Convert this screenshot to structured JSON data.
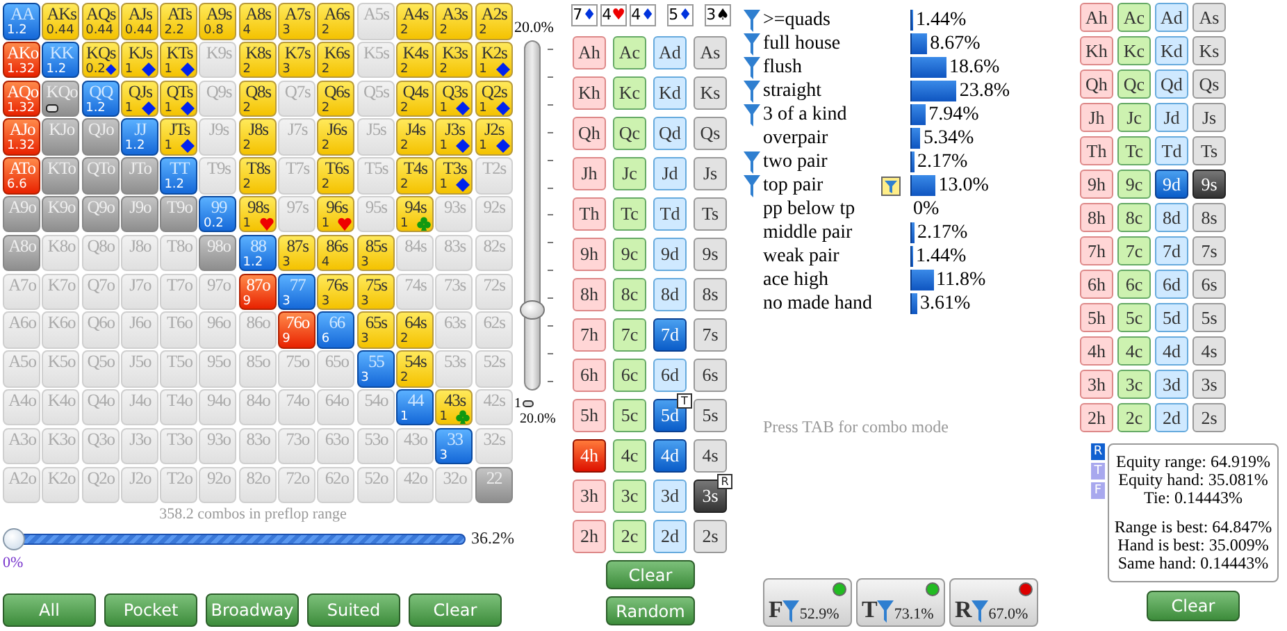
{
  "hand_grid": {
    "rows": [
      [
        {
          "label": "AA",
          "kind": "pair",
          "count": "1.2"
        },
        {
          "label": "AKs",
          "kind": "suited",
          "count": "0.44"
        },
        {
          "label": "AQs",
          "kind": "suited",
          "count": "0.44"
        },
        {
          "label": "AJs",
          "kind": "suited",
          "count": "0.44"
        },
        {
          "label": "ATs",
          "kind": "suited",
          "count": "2.2"
        },
        {
          "label": "A9s",
          "kind": "suited",
          "count": "0.8"
        },
        {
          "label": "A8s",
          "kind": "suited",
          "count": "4"
        },
        {
          "label": "A7s",
          "kind": "suited",
          "count": "3"
        },
        {
          "label": "A6s",
          "kind": "suited",
          "count": "2"
        },
        {
          "label": "A5s",
          "kind": "empty"
        },
        {
          "label": "A4s",
          "kind": "suited",
          "count": "2"
        },
        {
          "label": "A3s",
          "kind": "suited",
          "count": "2"
        },
        {
          "label": "A2s",
          "kind": "suited",
          "count": "2"
        }
      ],
      [
        {
          "label": "AKo",
          "kind": "offsuit",
          "count": "1.32"
        },
        {
          "label": "KK",
          "kind": "pair",
          "count": "1.2"
        },
        {
          "label": "KQs",
          "kind": "suited",
          "count": "0.2",
          "marker": {
            "kind": "diamond"
          }
        },
        {
          "label": "KJs",
          "kind": "suited",
          "count": "1",
          "marker": {
            "kind": "diamond"
          }
        },
        {
          "label": "KTs",
          "kind": "suited",
          "count": "1",
          "marker": {
            "kind": "diamond"
          }
        },
        {
          "label": "K9s",
          "kind": "empty"
        },
        {
          "label": "K8s",
          "kind": "suited",
          "count": "2"
        },
        {
          "label": "K7s",
          "kind": "suited",
          "count": "3"
        },
        {
          "label": "K6s",
          "kind": "suited",
          "count": "2"
        },
        {
          "label": "K5s",
          "kind": "empty"
        },
        {
          "label": "K4s",
          "kind": "suited",
          "count": "2"
        },
        {
          "label": "K3s",
          "kind": "suited",
          "count": "2"
        },
        {
          "label": "K2s",
          "kind": "suited",
          "count": "1",
          "marker": {
            "kind": "diamond"
          }
        }
      ],
      [
        {
          "label": "AQo",
          "kind": "offsuit",
          "count": "1.32"
        },
        {
          "label": "KQo",
          "kind": "dim",
          "marker": {
            "kind": "note"
          }
        },
        {
          "label": "QQ",
          "kind": "pair",
          "count": "1.2"
        },
        {
          "label": "QJs",
          "kind": "suited",
          "count": "1",
          "marker": {
            "kind": "diamond"
          }
        },
        {
          "label": "QTs",
          "kind": "suited",
          "count": "1",
          "marker": {
            "kind": "diamond"
          }
        },
        {
          "label": "Q9s",
          "kind": "empty"
        },
        {
          "label": "Q8s",
          "kind": "suited",
          "count": "2"
        },
        {
          "label": "Q7s",
          "kind": "empty"
        },
        {
          "label": "Q6s",
          "kind": "suited",
          "count": "2"
        },
        {
          "label": "Q5s",
          "kind": "empty"
        },
        {
          "label": "Q4s",
          "kind": "suited",
          "count": "2"
        },
        {
          "label": "Q3s",
          "kind": "suited",
          "count": "1",
          "marker": {
            "kind": "diamond"
          }
        },
        {
          "label": "Q2s",
          "kind": "suited",
          "count": "1",
          "marker": {
            "kind": "diamond"
          }
        }
      ],
      [
        {
          "label": "AJo",
          "kind": "offsuit",
          "count": "1.32"
        },
        {
          "label": "KJo",
          "kind": "dim"
        },
        {
          "label": "QJo",
          "kind": "dim"
        },
        {
          "label": "JJ",
          "kind": "pair",
          "count": "1.2"
        },
        {
          "label": "JTs",
          "kind": "suited",
          "count": "1",
          "marker": {
            "kind": "diamond"
          }
        },
        {
          "label": "J9s",
          "kind": "empty"
        },
        {
          "label": "J8s",
          "kind": "suited",
          "count": "2"
        },
        {
          "label": "J7s",
          "kind": "empty"
        },
        {
          "label": "J6s",
          "kind": "suited",
          "count": "2"
        },
        {
          "label": "J5s",
          "kind": "empty"
        },
        {
          "label": "J4s",
          "kind": "suited",
          "count": "2"
        },
        {
          "label": "J3s",
          "kind": "suited",
          "count": "1",
          "marker": {
            "kind": "diamond"
          }
        },
        {
          "label": "J2s",
          "kind": "suited",
          "count": "1",
          "marker": {
            "kind": "diamond"
          }
        }
      ],
      [
        {
          "label": "ATo",
          "kind": "offsuit",
          "count": "6.6"
        },
        {
          "label": "KTo",
          "kind": "dim"
        },
        {
          "label": "QTo",
          "kind": "dim"
        },
        {
          "label": "JTo",
          "kind": "dim"
        },
        {
          "label": "TT",
          "kind": "pair",
          "count": "1.2"
        },
        {
          "label": "T9s",
          "kind": "empty"
        },
        {
          "label": "T8s",
          "kind": "suited",
          "count": "2"
        },
        {
          "label": "T7s",
          "kind": "empty"
        },
        {
          "label": "T6s",
          "kind": "suited",
          "count": "2"
        },
        {
          "label": "T5s",
          "kind": "empty"
        },
        {
          "label": "T4s",
          "kind": "suited",
          "count": "2"
        },
        {
          "label": "T3s",
          "kind": "suited",
          "count": "1",
          "marker": {
            "kind": "diamond"
          }
        },
        {
          "label": "T2s",
          "kind": "empty"
        }
      ],
      [
        {
          "label": "A9o",
          "kind": "dim"
        },
        {
          "label": "K9o",
          "kind": "dim"
        },
        {
          "label": "Q9o",
          "kind": "dim"
        },
        {
          "label": "J9o",
          "kind": "dim"
        },
        {
          "label": "T9o",
          "kind": "dim"
        },
        {
          "label": "99",
          "kind": "pair",
          "count": "0.2"
        },
        {
          "label": "98s",
          "kind": "suited",
          "count": "1",
          "marker": {
            "kind": "heart"
          }
        },
        {
          "label": "97s",
          "kind": "empty"
        },
        {
          "label": "96s",
          "kind": "suited",
          "count": "1",
          "marker": {
            "kind": "heart"
          }
        },
        {
          "label": "95s",
          "kind": "empty"
        },
        {
          "label": "94s",
          "kind": "suited",
          "count": "1",
          "marker": {
            "kind": "club"
          }
        },
        {
          "label": "93s",
          "kind": "empty"
        },
        {
          "label": "92s",
          "kind": "empty"
        }
      ],
      [
        {
          "label": "A8o",
          "kind": "dim"
        },
        {
          "label": "K8o",
          "kind": "empty"
        },
        {
          "label": "Q8o",
          "kind": "empty"
        },
        {
          "label": "J8o",
          "kind": "empty"
        },
        {
          "label": "T8o",
          "kind": "empty"
        },
        {
          "label": "98o",
          "kind": "dim"
        },
        {
          "label": "88",
          "kind": "pair",
          "count": "1.2"
        },
        {
          "label": "87s",
          "kind": "suited",
          "count": "3"
        },
        {
          "label": "86s",
          "kind": "suited",
          "count": "4"
        },
        {
          "label": "85s",
          "kind": "suited",
          "count": "3"
        },
        {
          "label": "84s",
          "kind": "empty"
        },
        {
          "label": "83s",
          "kind": "empty"
        },
        {
          "label": "82s",
          "kind": "empty"
        }
      ],
      [
        {
          "label": "A7o",
          "kind": "empty"
        },
        {
          "label": "K7o",
          "kind": "empty"
        },
        {
          "label": "Q7o",
          "kind": "empty"
        },
        {
          "label": "J7o",
          "kind": "empty"
        },
        {
          "label": "T7o",
          "kind": "empty"
        },
        {
          "label": "97o",
          "kind": "empty"
        },
        {
          "label": "87o",
          "kind": "offsuit",
          "count": "9"
        },
        {
          "label": "77",
          "kind": "pair",
          "count": "3"
        },
        {
          "label": "76s",
          "kind": "suited",
          "count": "3"
        },
        {
          "label": "75s",
          "kind": "suited",
          "count": "3"
        },
        {
          "label": "74s",
          "kind": "empty"
        },
        {
          "label": "73s",
          "kind": "empty"
        },
        {
          "label": "72s",
          "kind": "empty"
        }
      ],
      [
        {
          "label": "A6o",
          "kind": "empty"
        },
        {
          "label": "K6o",
          "kind": "empty"
        },
        {
          "label": "Q6o",
          "kind": "empty"
        },
        {
          "label": "J6o",
          "kind": "empty"
        },
        {
          "label": "T6o",
          "kind": "empty"
        },
        {
          "label": "96o",
          "kind": "empty"
        },
        {
          "label": "86o",
          "kind": "empty"
        },
        {
          "label": "76o",
          "kind": "offsuit",
          "count": "9"
        },
        {
          "label": "66",
          "kind": "pair",
          "count": "6"
        },
        {
          "label": "65s",
          "kind": "suited",
          "count": "3"
        },
        {
          "label": "64s",
          "kind": "suited",
          "count": "2"
        },
        {
          "label": "63s",
          "kind": "empty"
        },
        {
          "label": "62s",
          "kind": "empty"
        }
      ],
      [
        {
          "label": "A5o",
          "kind": "empty"
        },
        {
          "label": "K5o",
          "kind": "empty"
        },
        {
          "label": "Q5o",
          "kind": "empty"
        },
        {
          "label": "J5o",
          "kind": "empty"
        },
        {
          "label": "T5o",
          "kind": "empty"
        },
        {
          "label": "95o",
          "kind": "empty"
        },
        {
          "label": "85o",
          "kind": "empty"
        },
        {
          "label": "75o",
          "kind": "empty"
        },
        {
          "label": "65o",
          "kind": "empty"
        },
        {
          "label": "55",
          "kind": "pair",
          "count": "3"
        },
        {
          "label": "54s",
          "kind": "suited",
          "count": "2"
        },
        {
          "label": "53s",
          "kind": "empty"
        },
        {
          "label": "52s",
          "kind": "empty"
        }
      ],
      [
        {
          "label": "A4o",
          "kind": "empty"
        },
        {
          "label": "K4o",
          "kind": "empty"
        },
        {
          "label": "Q4o",
          "kind": "empty"
        },
        {
          "label": "J4o",
          "kind": "empty"
        },
        {
          "label": "T4o",
          "kind": "empty"
        },
        {
          "label": "94o",
          "kind": "empty"
        },
        {
          "label": "84o",
          "kind": "empty"
        },
        {
          "label": "74o",
          "kind": "empty"
        },
        {
          "label": "64o",
          "kind": "empty"
        },
        {
          "label": "54o",
          "kind": "empty"
        },
        {
          "label": "44",
          "kind": "pair",
          "count": "1"
        },
        {
          "label": "43s",
          "kind": "suited",
          "count": "1",
          "marker": {
            "kind": "club"
          }
        },
        {
          "label": "42s",
          "kind": "empty"
        }
      ],
      [
        {
          "label": "A3o",
          "kind": "empty"
        },
        {
          "label": "K3o",
          "kind": "empty"
        },
        {
          "label": "Q3o",
          "kind": "empty"
        },
        {
          "label": "J3o",
          "kind": "empty"
        },
        {
          "label": "T3o",
          "kind": "empty"
        },
        {
          "label": "93o",
          "kind": "empty"
        },
        {
          "label": "83o",
          "kind": "empty"
        },
        {
          "label": "73o",
          "kind": "empty"
        },
        {
          "label": "63o",
          "kind": "empty"
        },
        {
          "label": "53o",
          "kind": "empty"
        },
        {
          "label": "43o",
          "kind": "empty"
        },
        {
          "label": "33",
          "kind": "pair",
          "count": "3"
        },
        {
          "label": "32s",
          "kind": "empty"
        }
      ],
      [
        {
          "label": "A2o",
          "kind": "empty"
        },
        {
          "label": "K2o",
          "kind": "empty"
        },
        {
          "label": "Q2o",
          "kind": "empty"
        },
        {
          "label": "J2o",
          "kind": "empty"
        },
        {
          "label": "T2o",
          "kind": "empty"
        },
        {
          "label": "92o",
          "kind": "empty"
        },
        {
          "label": "82o",
          "kind": "empty"
        },
        {
          "label": "72o",
          "kind": "empty"
        },
        {
          "label": "62o",
          "kind": "empty"
        },
        {
          "label": "52o",
          "kind": "empty"
        },
        {
          "label": "42o",
          "kind": "empty"
        },
        {
          "label": "32o",
          "kind": "empty"
        },
        {
          "label": "22",
          "kind": "dim"
        }
      ]
    ]
  },
  "preflop": {
    "combos_text": "358.2 combos in preflop range",
    "min_label": "0%",
    "max_label": "36.2%"
  },
  "range_buttons": [
    "All",
    "Pocket",
    "Broadway",
    "Suited",
    "Clear"
  ],
  "vertical_slider": {
    "top_label": "20.0%",
    "level": 0.23,
    "bottom_value": "1",
    "bottom_label": "20.0%"
  },
  "board": [
    {
      "rank": "7",
      "suit": "♦",
      "color": "#0033dd"
    },
    {
      "rank": "4",
      "suit": "♥",
      "color": "#ee0000"
    },
    {
      "rank": "4",
      "suit": "♦",
      "color": "#0033dd"
    },
    {
      "rank": "5",
      "suit": "♦",
      "color": "#0033dd"
    },
    {
      "rank": "3",
      "suit": "♠",
      "color": "#000000"
    }
  ],
  "board_cards": [
    [
      {
        "label": "Ah",
        "kind": "normal"
      },
      {
        "label": "Ac",
        "kind": "normal"
      },
      {
        "label": "Ad",
        "kind": "normal"
      },
      {
        "label": "As",
        "kind": "normal"
      }
    ],
    [
      {
        "label": "Kh",
        "kind": "normal"
      },
      {
        "label": "Kc",
        "kind": "normal"
      },
      {
        "label": "Kd",
        "kind": "normal"
      },
      {
        "label": "Ks",
        "kind": "normal"
      }
    ],
    [
      {
        "label": "Qh",
        "kind": "normal"
      },
      {
        "label": "Qc",
        "kind": "normal"
      },
      {
        "label": "Qd",
        "kind": "normal"
      },
      {
        "label": "Qs",
        "kind": "normal"
      }
    ],
    [
      {
        "label": "Jh",
        "kind": "normal"
      },
      {
        "label": "Jc",
        "kind": "normal"
      },
      {
        "label": "Jd",
        "kind": "normal"
      },
      {
        "label": "Js",
        "kind": "normal"
      }
    ],
    [
      {
        "label": "Th",
        "kind": "normal"
      },
      {
        "label": "Tc",
        "kind": "normal"
      },
      {
        "label": "Td",
        "kind": "normal"
      },
      {
        "label": "Ts",
        "kind": "normal"
      }
    ],
    [
      {
        "label": "9h",
        "kind": "normal"
      },
      {
        "label": "9c",
        "kind": "normal"
      },
      {
        "label": "9d",
        "kind": "normal"
      },
      {
        "label": "9s",
        "kind": "normal"
      }
    ],
    [
      {
        "label": "8h",
        "kind": "normal"
      },
      {
        "label": "8c",
        "kind": "normal"
      },
      {
        "label": "8d",
        "kind": "normal"
      },
      {
        "label": "8s",
        "kind": "normal"
      }
    ],
    [
      {
        "label": "7h",
        "kind": "normal"
      },
      {
        "label": "7c",
        "kind": "normal"
      },
      {
        "label": "7d",
        "kind": "board"
      },
      {
        "label": "7s",
        "kind": "normal"
      }
    ],
    [
      {
        "label": "6h",
        "kind": "normal"
      },
      {
        "label": "6c",
        "kind": "normal"
      },
      {
        "label": "6d",
        "kind": "normal"
      },
      {
        "label": "6s",
        "kind": "normal"
      }
    ],
    [
      {
        "label": "5h",
        "kind": "normal"
      },
      {
        "label": "5c",
        "kind": "normal"
      },
      {
        "label": "5d",
        "kind": "board",
        "badge": "T"
      },
      {
        "label": "5s",
        "kind": "normal"
      }
    ],
    [
      {
        "label": "4h",
        "kind": "hand"
      },
      {
        "label": "4c",
        "kind": "normal"
      },
      {
        "label": "4d",
        "kind": "board"
      },
      {
        "label": "4s",
        "kind": "normal"
      }
    ],
    [
      {
        "label": "3h",
        "kind": "normal"
      },
      {
        "label": "3c",
        "kind": "normal"
      },
      {
        "label": "3d",
        "kind": "normal"
      },
      {
        "label": "3s",
        "kind": "dead",
        "badge": "R"
      }
    ],
    [
      {
        "label": "2h",
        "kind": "normal"
      },
      {
        "label": "2c",
        "kind": "normal"
      },
      {
        "label": "2d",
        "kind": "normal"
      },
      {
        "label": "2s",
        "kind": "normal"
      }
    ]
  ],
  "board_card_buttons": [
    "Clear",
    "Random"
  ],
  "hand_stats": [
    {
      "name": ">=quads",
      "filter": true,
      "filter_box": false,
      "value": "1.44%"
    },
    {
      "name": "full house",
      "filter": true,
      "filter_box": false,
      "value": "8.67%"
    },
    {
      "name": "flush",
      "filter": true,
      "filter_box": false,
      "value": "18.6%"
    },
    {
      "name": "straight",
      "filter": true,
      "filter_box": false,
      "value": "23.8%"
    },
    {
      "name": "3 of a kind",
      "filter": true,
      "filter_box": false,
      "value": "7.94%"
    },
    {
      "name": "overpair",
      "filter": false,
      "filter_box": false,
      "value": "5.34%"
    },
    {
      "name": "two pair",
      "filter": true,
      "filter_box": false,
      "value": "2.17%"
    },
    {
      "name": "top pair",
      "filter": true,
      "filter_box": true,
      "value": "13.0%"
    },
    {
      "name": "pp below tp",
      "filter": false,
      "filter_box": false,
      "value": "0%"
    },
    {
      "name": "middle pair",
      "filter": false,
      "filter_box": false,
      "value": "2.17%"
    },
    {
      "name": "weak pair",
      "filter": false,
      "filter_box": false,
      "value": "1.44%"
    },
    {
      "name": "ace high",
      "filter": false,
      "filter_box": false,
      "value": "11.8%"
    },
    {
      "name": "no made hand",
      "filter": false,
      "filter_box": false,
      "value": "3.61%"
    }
  ],
  "hint": "Press TAB for combo mode",
  "filter_buttons": [
    {
      "letter": "F",
      "value": "52.9%",
      "color": "#22bb22"
    },
    {
      "letter": "T",
      "value": "73.1%",
      "color": "#22bb22"
    },
    {
      "letter": "R",
      "value": "67.0%",
      "color": "#dd0000"
    }
  ],
  "hand_cards": [
    [
      {
        "label": "Ah",
        "kind": "normal"
      },
      {
        "label": "Ac",
        "kind": "normal"
      },
      {
        "label": "Ad",
        "kind": "normal"
      },
      {
        "label": "As",
        "kind": "normal"
      }
    ],
    [
      {
        "label": "Kh",
        "kind": "normal"
      },
      {
        "label": "Kc",
        "kind": "normal"
      },
      {
        "label": "Kd",
        "kind": "normal"
      },
      {
        "label": "Ks",
        "kind": "normal"
      }
    ],
    [
      {
        "label": "Qh",
        "kind": "normal"
      },
      {
        "label": "Qc",
        "kind": "normal"
      },
      {
        "label": "Qd",
        "kind": "normal"
      },
      {
        "label": "Qs",
        "kind": "normal"
      }
    ],
    [
      {
        "label": "Jh",
        "kind": "normal"
      },
      {
        "label": "Jc",
        "kind": "normal"
      },
      {
        "label": "Jd",
        "kind": "normal"
      },
      {
        "label": "Js",
        "kind": "normal"
      }
    ],
    [
      {
        "label": "Th",
        "kind": "normal"
      },
      {
        "label": "Tc",
        "kind": "normal"
      },
      {
        "label": "Td",
        "kind": "normal"
      },
      {
        "label": "Ts",
        "kind": "normal"
      }
    ],
    [
      {
        "label": "9h",
        "kind": "normal"
      },
      {
        "label": "9c",
        "kind": "normal"
      },
      {
        "label": "9d",
        "kind": "board"
      },
      {
        "label": "9s",
        "kind": "dead"
      }
    ],
    [
      {
        "label": "8h",
        "kind": "normal"
      },
      {
        "label": "8c",
        "kind": "normal"
      },
      {
        "label": "8d",
        "kind": "normal"
      },
      {
        "label": "8s",
        "kind": "normal"
      }
    ],
    [
      {
        "label": "7h",
        "kind": "normal"
      },
      {
        "label": "7c",
        "kind": "normal"
      },
      {
        "label": "7d",
        "kind": "normal"
      },
      {
        "label": "7s",
        "kind": "normal"
      }
    ],
    [
      {
        "label": "6h",
        "kind": "normal"
      },
      {
        "label": "6c",
        "kind": "normal"
      },
      {
        "label": "6d",
        "kind": "normal"
      },
      {
        "label": "6s",
        "kind": "normal"
      }
    ],
    [
      {
        "label": "5h",
        "kind": "normal"
      },
      {
        "label": "5c",
        "kind": "normal"
      },
      {
        "label": "5d",
        "kind": "normal"
      },
      {
        "label": "5s",
        "kind": "normal"
      }
    ],
    [
      {
        "label": "4h",
        "kind": "normal"
      },
      {
        "label": "4c",
        "kind": "normal"
      },
      {
        "label": "4d",
        "kind": "normal"
      },
      {
        "label": "4s",
        "kind": "normal"
      }
    ],
    [
      {
        "label": "3h",
        "kind": "normal"
      },
      {
        "label": "3c",
        "kind": "normal"
      },
      {
        "label": "3d",
        "kind": "normal"
      },
      {
        "label": "3s",
        "kind": "normal"
      }
    ],
    [
      {
        "label": "2h",
        "kind": "normal"
      },
      {
        "label": "2c",
        "kind": "normal"
      },
      {
        "label": "2d",
        "kind": "normal"
      },
      {
        "label": "2s",
        "kind": "normal"
      }
    ]
  ],
  "equity": {
    "tabs": [
      {
        "label": "R",
        "selected": true
      },
      {
        "label": "T",
        "selected": false
      },
      {
        "label": "F",
        "selected": false
      }
    ],
    "groups": [
      [
        "Equity range: 64.919%",
        "Equity hand: 35.081%",
        "Tie: 0.14443%"
      ],
      [
        "Range is best: 64.847%",
        "Hand is best: 35.009%",
        "Same hand: 0.14443%"
      ]
    ]
  },
  "hand_cards_button": "Clear"
}
